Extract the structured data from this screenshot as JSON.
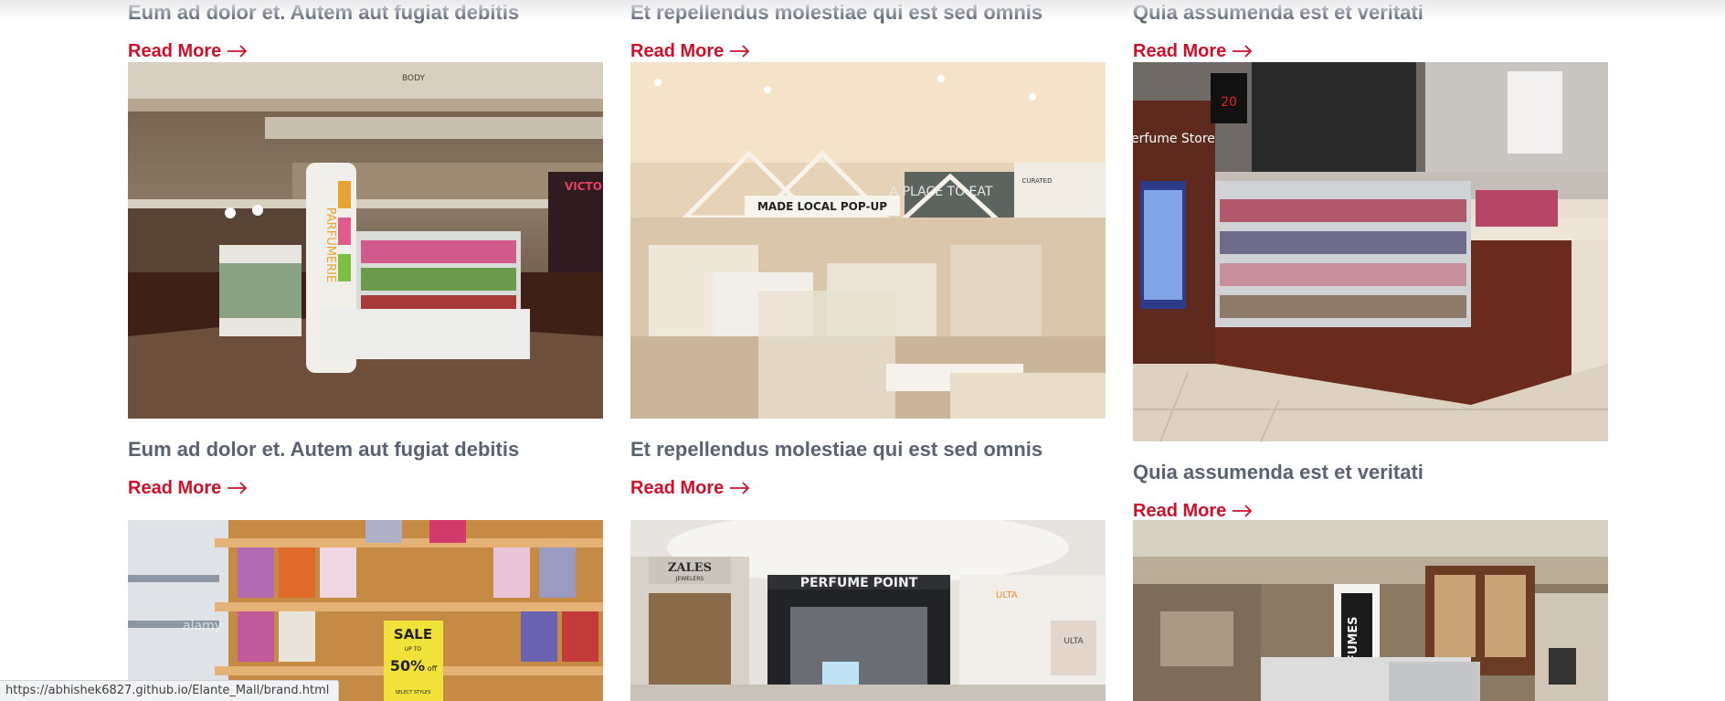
{
  "grid": {
    "row1": [
      {
        "title": "Eum ad dolor et. Autem aut fugiat debitis",
        "read_more": "Read More",
        "image_alt": "Parfumerie kiosk in mall atrium"
      },
      {
        "title": "Et repellendus molestiae qui est sed omnis",
        "read_more": "Read More",
        "image_alt": "Made Local pop-up store interior"
      },
      {
        "title": "Quia assumenda est et veritati",
        "read_more": "Read More",
        "image_alt": "Perfume Store kiosk with glass displays"
      }
    ],
    "row2": [
      {
        "title": "Eum ad dolor et. Autem aut fugiat debitis",
        "read_more": "Read More",
        "image_alt": "Perfume shelves with sale sign"
      },
      {
        "title": "Et repellendus molestiae qui est sed omnis",
        "read_more": "Read More",
        "image_alt": "Perfume Point storefront next to Zales"
      },
      {
        "title": "Quia assumenda est et veritati",
        "read_more": "Read More",
        "image_alt": "Perfumes kiosk in mall corridor"
      }
    ],
    "partial_titles": [
      "Eum ad dolor et. Autem aut fugiat debitis",
      "Et repellendus molestiae qui est sed omnis",
      "Quia assumenda est et veritati"
    ]
  },
  "image_text": {
    "img1_sign": "PARFUMERIE",
    "img1_store": "VICTOR",
    "img1_body": "BODY",
    "img2_sign": "MADE LOCAL POP-UP",
    "img2_sign2": "A PLACE TO EAT",
    "img2_curated": "CURATED",
    "img3_sign": "Perfume Store",
    "img3_sale": "20",
    "img4_sale": "SALE",
    "img4_upto": "UP TO",
    "img4_pct": "50%",
    "img4_off": "off",
    "img4_styles": "SELECT STYLES",
    "img4_wm": "alamy",
    "img5_zales": "ZALES",
    "img5_jewelers": "JEWELERS",
    "img5_store": "PERFUME POINT",
    "img5_ulta": "ULTA",
    "img6_sign": "PERFUMES"
  },
  "status_bar": {
    "url": "https://abhishek6827.github.io/Elante_Mall/brand.html"
  },
  "colors": {
    "title": "#5a6272",
    "accent": "#d0102a",
    "background": "#ffffff"
  }
}
